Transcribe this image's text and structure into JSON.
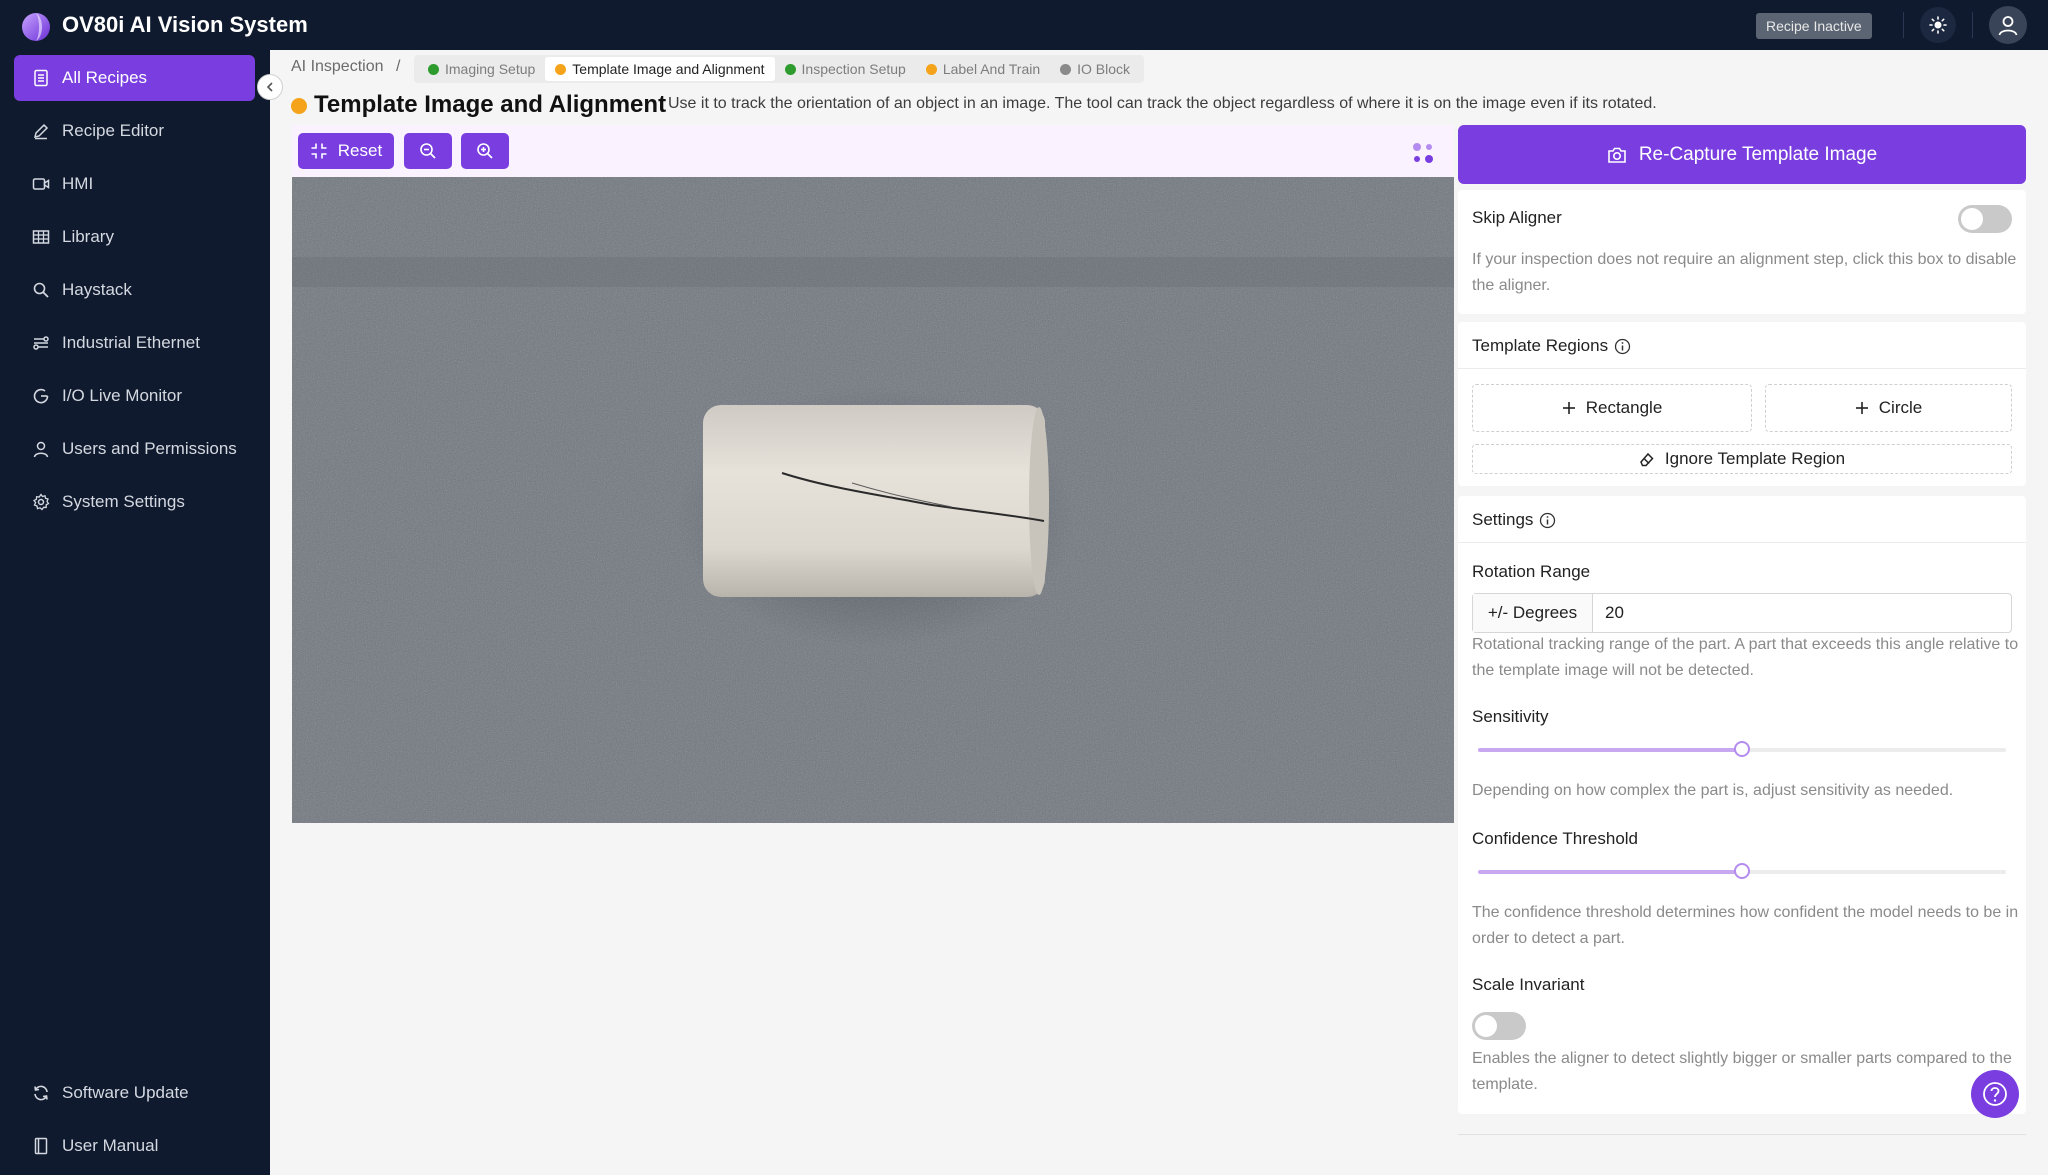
{
  "app": {
    "title": "OV80i AI Vision System",
    "recipe_status": "Recipe Inactive"
  },
  "sidebar": {
    "items": [
      {
        "label": "All Recipes",
        "icon": "document-icon",
        "active": true
      },
      {
        "label": "Recipe Editor",
        "icon": "pencil-icon"
      },
      {
        "label": "HMI",
        "icon": "video-icon"
      },
      {
        "label": "Library",
        "icon": "grid-icon"
      },
      {
        "label": "Haystack",
        "icon": "search-icon"
      },
      {
        "label": "Industrial Ethernet",
        "icon": "network-icon"
      },
      {
        "label": "I/O Live Monitor",
        "icon": "gauge-icon"
      },
      {
        "label": "Users and Permissions",
        "icon": "user-icon"
      },
      {
        "label": "System Settings",
        "icon": "gear-icon"
      }
    ],
    "bottom": [
      {
        "label": "Software Update",
        "icon": "refresh-icon"
      },
      {
        "label": "User Manual",
        "icon": "book-icon"
      }
    ]
  },
  "breadcrumb": {
    "root": "AI Inspection",
    "separator": "/",
    "tabs": [
      {
        "label": "Imaging Setup",
        "color": "#2e9b2e"
      },
      {
        "label": "Template Image and Alignment",
        "color": "#f5a31a",
        "active": true
      },
      {
        "label": "Inspection Setup",
        "color": "#2e9b2e"
      },
      {
        "label": "Label And Train",
        "color": "#f5a31a"
      },
      {
        "label": "IO Block",
        "color": "#8a8a8a"
      }
    ]
  },
  "page": {
    "title": "Template Image and Alignment",
    "description": "Use it to track the orientation of an object in an image. The tool can track the object regardless of where it is on the image even if its rotated."
  },
  "toolbar": {
    "reset_label": "Reset"
  },
  "panel": {
    "recapture_label": "Re-Capture Template Image",
    "skip_aligner": {
      "title": "Skip Aligner",
      "enabled": false,
      "help": "If your inspection does not require an alignment step, click this box to disable the aligner."
    },
    "template_regions": {
      "title": "Template Regions",
      "rectangle_label": "Rectangle",
      "circle_label": "Circle",
      "ignore_label": "Ignore Template Region"
    },
    "settings": {
      "title": "Settings",
      "rotation_range": {
        "label": "Rotation Range",
        "addon": "+/- Degrees",
        "value": "20",
        "help": "Rotational tracking range of the part. A part that exceeds this angle relative to the template image will not be detected."
      },
      "sensitivity": {
        "label": "Sensitivity",
        "value_fraction": 0.5,
        "help": "Depending on how complex the part is, adjust sensitivity as needed."
      },
      "confidence_threshold": {
        "label": "Confidence Threshold",
        "value_fraction": 0.5,
        "help": "The confidence threshold determines how confident the model needs to be in order to detect a part."
      },
      "scale_invariant": {
        "label": "Scale Invariant",
        "enabled": false,
        "help": "Enables the aligner to detect slightly bigger or smaller parts compared to the template."
      }
    }
  },
  "colors": {
    "accent": "#7a3ee0",
    "sidebar_bg": "#0f1a2e"
  }
}
